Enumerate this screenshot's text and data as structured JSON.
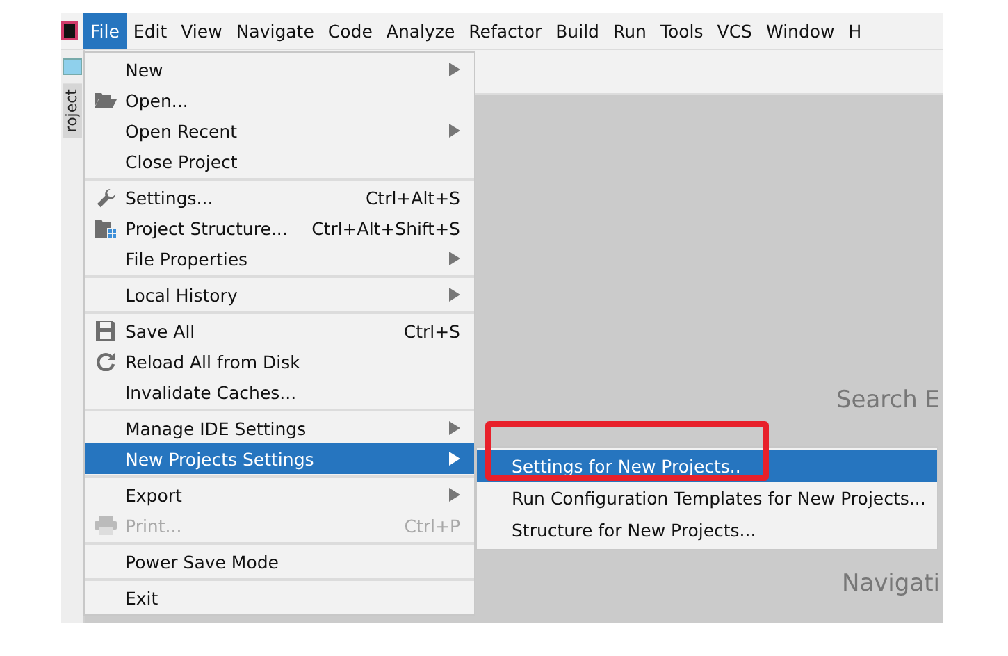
{
  "menu_bar": [
    {
      "label": "File",
      "selected": true
    },
    {
      "label": "Edit",
      "selected": false
    },
    {
      "label": "View",
      "selected": false
    },
    {
      "label": "Navigate",
      "selected": false
    },
    {
      "label": "Code",
      "selected": false
    },
    {
      "label": "Analyze",
      "selected": false
    },
    {
      "label": "Refactor",
      "selected": false
    },
    {
      "label": "Build",
      "selected": false
    },
    {
      "label": "Run",
      "selected": false
    },
    {
      "label": "Tools",
      "selected": false
    },
    {
      "label": "VCS",
      "selected": false
    },
    {
      "label": "Window",
      "selected": false
    },
    {
      "label": "H",
      "selected": false
    }
  ],
  "side_tab": "roject",
  "file_menu": {
    "groups": [
      [
        {
          "label": "New",
          "kind": "plain",
          "submenu": true,
          "selected": false,
          "disabled": false
        },
        {
          "label": "Open...",
          "kind": "folder",
          "submenu": false,
          "selected": false,
          "disabled": false
        },
        {
          "label": "Open Recent",
          "kind": "plain",
          "submenu": true,
          "selected": false,
          "disabled": false
        },
        {
          "label": "Close Project",
          "kind": "plain",
          "submenu": false,
          "selected": false,
          "disabled": false
        }
      ],
      [
        {
          "label": "Settings...",
          "kind": "wrench",
          "shortcut": "Ctrl+Alt+S",
          "submenu": false,
          "selected": false,
          "disabled": false
        },
        {
          "label": "Project Structure...",
          "kind": "structure",
          "shortcut": "Ctrl+Alt+Shift+S",
          "submenu": false,
          "selected": false,
          "disabled": false
        },
        {
          "label": "File Properties",
          "kind": "plain",
          "submenu": true,
          "selected": false,
          "disabled": false
        }
      ],
      [
        {
          "label": "Local History",
          "kind": "plain",
          "submenu": true,
          "selected": false,
          "disabled": false
        }
      ],
      [
        {
          "label": "Save All",
          "kind": "save",
          "shortcut": "Ctrl+S",
          "submenu": false,
          "selected": false,
          "disabled": false
        },
        {
          "label": "Reload All from Disk",
          "kind": "reload",
          "submenu": false,
          "selected": false,
          "disabled": false
        },
        {
          "label": "Invalidate Caches...",
          "kind": "plain",
          "submenu": false,
          "selected": false,
          "disabled": false
        }
      ],
      [
        {
          "label": "Manage IDE Settings",
          "kind": "plain",
          "submenu": true,
          "selected": false,
          "disabled": false
        },
        {
          "label": "New Projects Settings",
          "kind": "plain",
          "submenu": true,
          "selected": true,
          "disabled": false
        }
      ],
      [
        {
          "label": "Export",
          "kind": "plain",
          "submenu": true,
          "selected": false,
          "disabled": false
        },
        {
          "label": "Print...",
          "kind": "print",
          "shortcut": "Ctrl+P",
          "submenu": false,
          "selected": false,
          "disabled": true
        }
      ],
      [
        {
          "label": "Power Save Mode",
          "kind": "plain",
          "submenu": false,
          "selected": false,
          "disabled": false
        }
      ],
      [
        {
          "label": "Exit",
          "kind": "plain",
          "submenu": false,
          "selected": false,
          "disabled": false
        }
      ]
    ]
  },
  "submenu": [
    {
      "label": "Settings for New Projects..",
      "selected": true
    },
    {
      "label": "Run Configuration Templates for New Projects...",
      "selected": false
    },
    {
      "label": "Structure for New Projects...",
      "selected": false
    }
  ],
  "highlight_box": true,
  "welcome_texts": [
    "Search E",
    "Navigati"
  ]
}
